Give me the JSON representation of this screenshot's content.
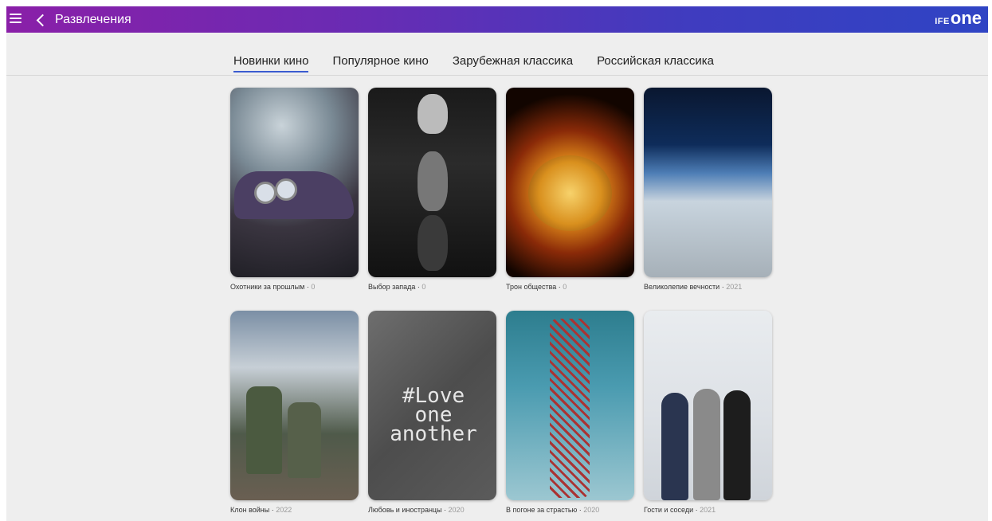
{
  "topbar": {
    "back_label": "Развлечения",
    "logo_ife": "IFE",
    "logo_one": "one"
  },
  "tabs": [
    {
      "label": "Новинки кино",
      "active": true
    },
    {
      "label": "Популярное кино",
      "active": false
    },
    {
      "label": "Зарубежная классика",
      "active": false
    },
    {
      "label": "Российская классика",
      "active": false
    }
  ],
  "movies": [
    {
      "title": "Охотники за прошлым",
      "year": "0"
    },
    {
      "title": "Выбор запада",
      "year": "0"
    },
    {
      "title": "Трон общества",
      "year": "0"
    },
    {
      "title": "Великолепие вечности",
      "year": "2021"
    },
    {
      "title": "Клон войны",
      "year": "2022"
    },
    {
      "title": "Любовь и иностранцы",
      "year": "2020"
    },
    {
      "title": "В погоне за страстью",
      "year": "2020"
    },
    {
      "title": "Гости и соседи",
      "year": "2021"
    }
  ],
  "thumb_texts": {
    "love": "#Love one another"
  },
  "colors": {
    "accent": "#3a5bd0",
    "topbar_start": "#8a1fa8",
    "topbar_end": "#2f44c4"
  }
}
